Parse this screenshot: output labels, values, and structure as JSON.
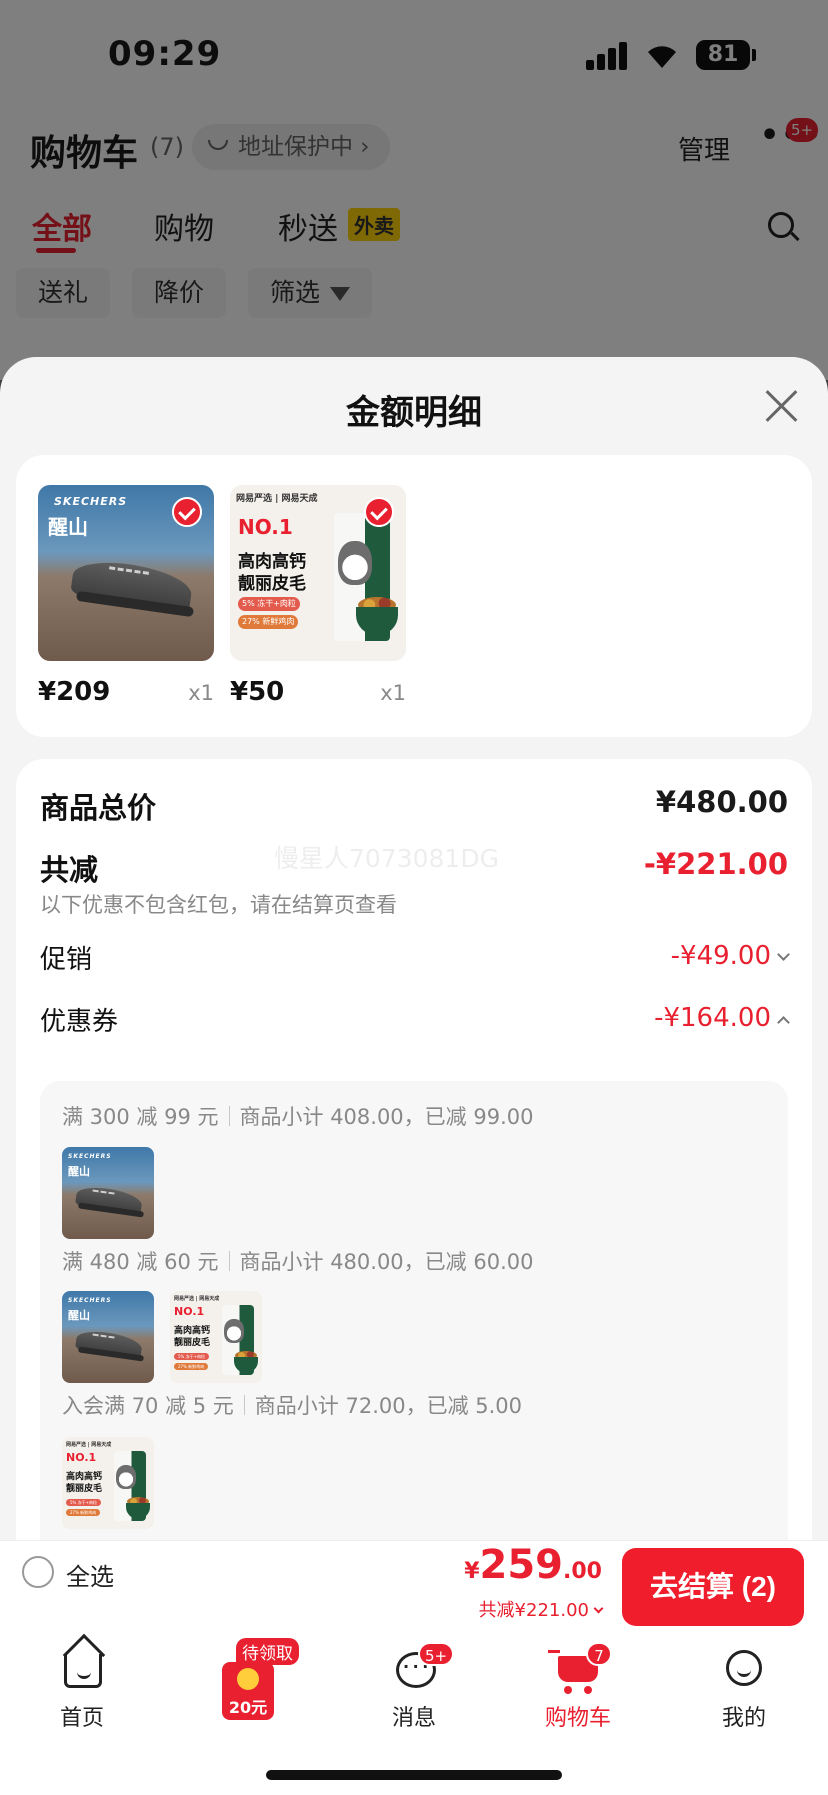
{
  "status_bar": {
    "time": "09:29",
    "battery": "81"
  },
  "cart_header": {
    "title": "购物车",
    "count": "(7)",
    "address_protect": "地址保护中 ›",
    "manage": "管理",
    "more": "•••",
    "more_badge": "5+"
  },
  "tabs": {
    "all": "全部",
    "shopping": "购物",
    "flash": "秒送",
    "waimai": "外卖"
  },
  "filters": {
    "gift": "送礼",
    "price_drop": "降价",
    "filter": "筛选"
  },
  "sheet": {
    "title": "金额明细",
    "products": [
      {
        "price": "¥209",
        "qty": "x1",
        "brand": "SKECHERS",
        "art_text": "醒山"
      },
      {
        "price": "¥50",
        "qty": "x1",
        "logos": "网易严选 | 网易天成",
        "badge": "NO.1",
        "line1": "高肉高钙",
        "line2": "靓丽皮毛",
        "pill1": "5% 冻干+肉粒",
        "pill2": "27% 新鲜鸡肉"
      }
    ],
    "summary": {
      "total_label": "商品总价",
      "total_value": "¥480.00",
      "discount_label": "共减",
      "discount_value": "-¥221.00",
      "discount_note": "以下优惠不包含红包，请在结算页查看",
      "watermark": "慢星人7073081DG",
      "promo_label": "促销",
      "promo_value": "-¥49.00",
      "coupon_label": "优惠券",
      "coupon_value": "-¥164.00"
    },
    "coupons": [
      {
        "rule": "满 300 减 99 元",
        "detail": "商品小计 408.00，已减 99.00"
      },
      {
        "rule": "满 480 减 60 元",
        "detail": "商品小计 480.00，已减 60.00"
      },
      {
        "rule": "入会满 70 减 5 元",
        "detail": "商品小计 72.00，已减 5.00"
      }
    ]
  },
  "checkout": {
    "select_all": "全选",
    "yen": "¥",
    "total_int": "259",
    "total_dec": ".00",
    "saved": "共减¥221.00",
    "button": "去结算 (2)"
  },
  "tabbar": {
    "home": "首页",
    "redpacket_tag": "待领取",
    "redpacket_amount": "20元",
    "messages": "消息",
    "messages_badge": "5+",
    "cart": "购物车",
    "cart_badge": "7",
    "me": "我的"
  },
  "colors": {
    "accent": "#e8202f",
    "waimai": "#ffd20a"
  }
}
